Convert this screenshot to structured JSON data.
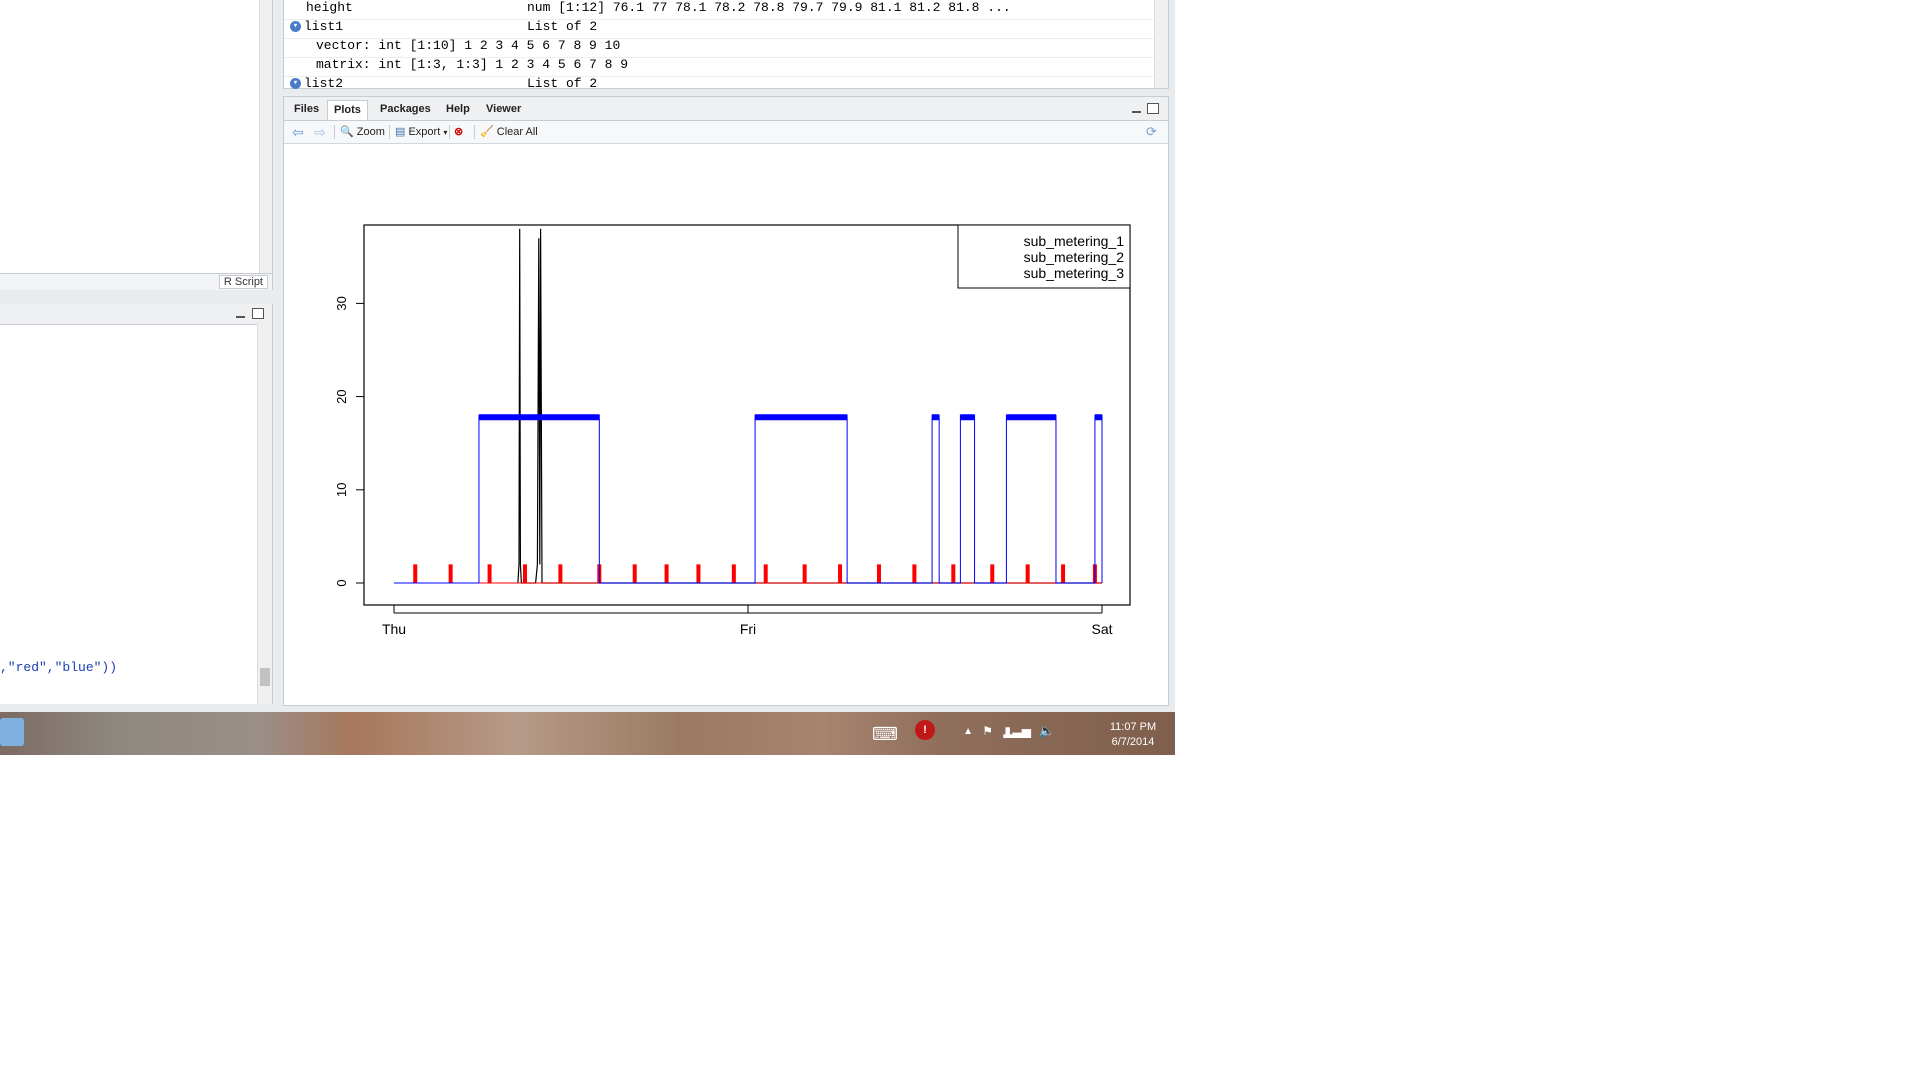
{
  "environment": {
    "rows": [
      {
        "name": "height",
        "value": "num [1:12] 76.1 77 78.1 78.2 78.8 79.7 79.9 81.1 81.2 81.8 ...",
        "indent": 1,
        "expander": false
      },
      {
        "name": "list1",
        "value": "List of 2",
        "indent": 0,
        "expander": true
      },
      {
        "name": "vector: int [1:10] 1 2 3 4 5 6 7 8 9 10",
        "value": "",
        "indent": 2,
        "expander": false
      },
      {
        "name": "matrix: int [1:3, 1:3] 1 2 3 4 5 6 7 8 9",
        "value": "",
        "indent": 2,
        "expander": false
      },
      {
        "name": "list2",
        "value": "List of 2",
        "indent": 0,
        "expander": true
      }
    ]
  },
  "editor": {
    "file_type": "R Script"
  },
  "console": {
    "partial_line": ",\"red\",\"blue\"))"
  },
  "plots_pane": {
    "tabs": [
      "Files",
      "Plots",
      "Packages",
      "Help",
      "Viewer"
    ],
    "active_tab": "Plots",
    "toolbar": {
      "zoom": "Zoom",
      "export": "Export",
      "clear_all": "Clear All"
    }
  },
  "taskbar": {
    "time": "11:07 PM",
    "date": "6/7/2014"
  },
  "chart_data": {
    "type": "line",
    "title": "",
    "xlabel": "",
    "ylabel": "",
    "x_ticks": [
      "Thu",
      "Fri",
      "Sat"
    ],
    "y_ticks": [
      0,
      10,
      20,
      30
    ],
    "ylim": [
      0,
      39
    ],
    "xlim_days": [
      0,
      2
    ],
    "legend": {
      "position": "top-right",
      "entries": [
        "sub_metering_1",
        "sub_metering_2",
        "sub_metering_3"
      ]
    },
    "series": [
      {
        "name": "sub_metering_1",
        "color": "#000000",
        "style": "line",
        "x": [
          0.35,
          0.353,
          0.355,
          0.357,
          0.36,
          0.385,
          0.4,
          0.405,
          0.409,
          0.412,
          0.414,
          0.418,
          0.425,
          0.429,
          0.43,
          0.55,
          1.0,
          2.0
        ],
        "y": [
          0,
          2,
          38,
          2,
          0,
          0,
          0,
          2,
          37,
          2,
          38,
          0,
          0,
          0,
          0,
          0,
          0,
          0
        ]
      },
      {
        "name": "sub_metering_2",
        "color": "#ff0000",
        "style": "spikes",
        "x": [
          0.06,
          0.16,
          0.27,
          0.37,
          0.47,
          0.58,
          0.68,
          0.77,
          0.86,
          0.96,
          1.05,
          1.16,
          1.26,
          1.37,
          1.47,
          1.58,
          1.69,
          1.79,
          1.89,
          1.98
        ],
        "y": [
          2,
          2,
          2,
          2,
          2,
          2,
          2,
          2,
          2,
          2,
          2,
          2,
          2,
          2,
          2,
          2,
          2,
          2,
          2,
          2
        ]
      },
      {
        "name": "sub_metering_3",
        "color": "#0000ff",
        "style": "blocks",
        "x": [
          0.0,
          0.24,
          0.58,
          0.82,
          1.02,
          1.28,
          1.36,
          1.52,
          1.54,
          1.6,
          1.64,
          1.73,
          1.87,
          1.92,
          1.98,
          2.0
        ],
        "y": [
          0,
          18,
          0,
          0,
          18,
          0,
          0,
          18,
          0,
          18,
          0,
          18,
          0,
          0,
          18,
          0
        ]
      }
    ]
  }
}
